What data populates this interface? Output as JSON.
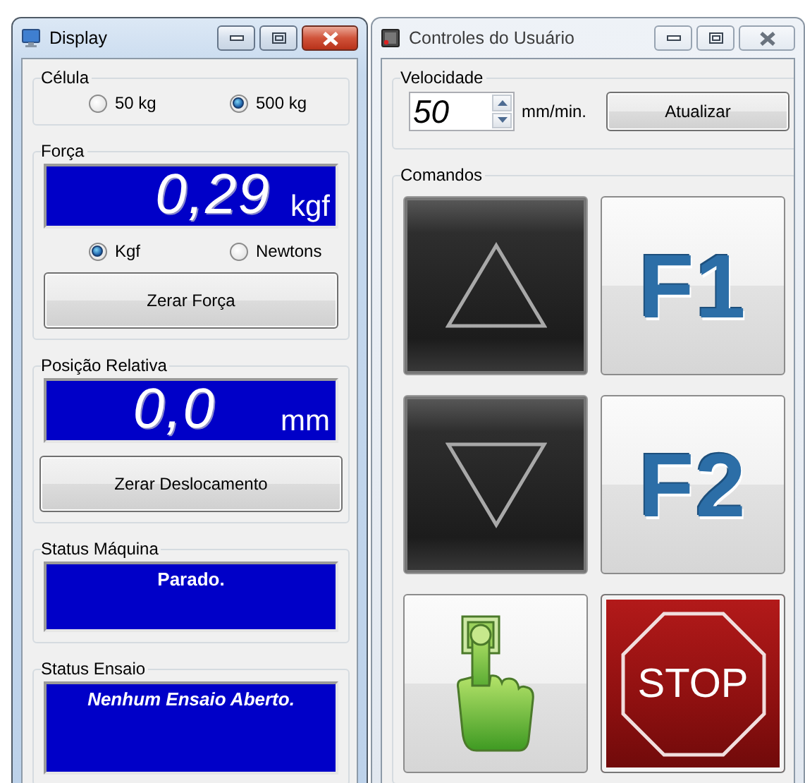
{
  "display_window": {
    "title": "Display",
    "active": true,
    "celula": {
      "label": "Célula",
      "options": [
        {
          "label": "50 kg",
          "selected": false
        },
        {
          "label": "500 kg",
          "selected": true
        }
      ]
    },
    "forca": {
      "label": "Força",
      "value": "0,29",
      "unit": "kgf",
      "options": [
        {
          "label": "Kgf",
          "selected": true
        },
        {
          "label": "Newtons",
          "selected": false
        }
      ],
      "button": "Zerar Força"
    },
    "posicao_relativa": {
      "label": "Posição Relativa",
      "value": "0,0",
      "unit": "mm",
      "button": "Zerar Deslocamento"
    },
    "status_maquina": {
      "label": "Status Máquina",
      "text": "Parado."
    },
    "status_ensaio": {
      "label": "Status Ensaio",
      "text": "Nenhum Ensaio Aberto."
    }
  },
  "controls_window": {
    "title": "Controles do Usuário",
    "active": false,
    "velocidade": {
      "label": "Velocidade",
      "value": "50",
      "unit": "mm/min.",
      "button": "Atualizar"
    },
    "comandos": {
      "label": "Comandos",
      "buttons": [
        {
          "kind": "up"
        },
        {
          "kind": "function",
          "label": "F1"
        },
        {
          "kind": "down"
        },
        {
          "kind": "function",
          "label": "F2"
        },
        {
          "kind": "start"
        },
        {
          "kind": "stop",
          "label": "STOP"
        }
      ]
    }
  }
}
